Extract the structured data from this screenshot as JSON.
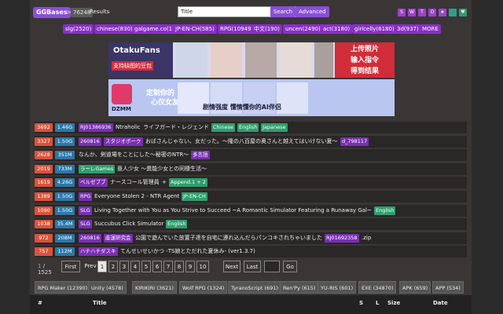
{
  "header": {
    "logo": "GGBases",
    "sep": ">",
    "count": "76248",
    "results_label": "Results",
    "search_value": "Title",
    "search_btn": "Search",
    "advanced_btn": "Advanced",
    "squares": [
      "S",
      "W",
      "T",
      "O",
      "★"
    ],
    "green_icons": [
      "green-square-icon",
      "heart-icon"
    ]
  },
  "tags": [
    "slg(2520)",
    "chinese(830)",
    "galgame.co(1)",
    "JP-EN-CH(585)",
    "RPG(10949)",
    "中文(190)",
    "uncen(2490)",
    "act(3180)",
    "girlcelly(6180)",
    "3d(937)",
    "MORE"
  ],
  "ads": {
    "brand1": "OtakuFans",
    "sub1": "支持缺图的豆包",
    "red1": "上传照片",
    "red2": "输入指令",
    "red3": "得到结果",
    "brand2": "DZMM",
    "mid2a": "定制你的",
    "mid2b": "心仪女友",
    "right2": "剧情强度 懂情懂你的AI伴侣"
  },
  "rows": [
    {
      "num": "3692",
      "size": "1.46G",
      "parts": [
        {
          "t": "RJ01386936",
          "c": "tpurple"
        },
        {
          "t": "Ntraholic",
          "c": "title"
        },
        {
          "t": "ライフガード・レジェンド",
          "c": "title"
        },
        {
          "t": "Chinese",
          "c": "tg"
        },
        {
          "t": "English",
          "c": "tg"
        },
        {
          "t": "Japanese",
          "c": "tg"
        }
      ]
    },
    {
      "num": "3327",
      "size": "1.50G",
      "parts": [
        {
          "t": "260816",
          "c": "tpurple"
        },
        {
          "t": "スタジオポーク",
          "c": "tpurple"
        },
        {
          "t": "おばさんじゃない、女だった。～隆の八百屋の奥さんと越えてはいけない夏～",
          "c": "title"
        },
        {
          "t": "d_798117",
          "c": "tpurple"
        }
      ]
    },
    {
      "num": "2628",
      "size": "351M",
      "parts": [
        {
          "t": "なんか、剣道場をことにした～秘密のNTR～",
          "c": "title"
        },
        {
          "t": "多言語",
          "c": "tpurple"
        }
      ]
    },
    {
      "num": "2019",
      "size": "733M",
      "parts": [
        {
          "t": "ラーレGames",
          "c": "tg"
        },
        {
          "t": "亜人少女 ～異能少女との同棲生活～",
          "c": "title"
        }
      ]
    },
    {
      "num": "1619",
      "size": "4.26G",
      "parts": [
        {
          "t": "ベルゼブブ",
          "c": "tpurple"
        },
        {
          "t": "ナースコール管理員",
          "c": "title"
        },
        {
          "t": "+",
          "c": "title"
        },
        {
          "t": "Append.1 + 2",
          "c": "tg"
        }
      ]
    },
    {
      "num": "1389",
      "size": "1.50G",
      "parts": [
        {
          "t": "RPG",
          "c": "tpurple"
        },
        {
          "t": "Everyone Stolen 2 - NTR Agent",
          "c": "title"
        },
        {
          "t": "JP-EN-CH",
          "c": "tg"
        }
      ]
    },
    {
      "num": "1090",
      "size": "1.50G",
      "parts": [
        {
          "t": "SLG",
          "c": "tpurple"
        },
        {
          "t": "Living Together with You as You Strive to Succeed ~A Romantic Simulator Featuring a Runaway Gal~",
          "c": "title"
        },
        {
          "t": "English",
          "c": "tg"
        }
      ]
    },
    {
      "num": "1038",
      "size": "35.4M",
      "parts": [
        {
          "t": "SLG",
          "c": "tpurple"
        },
        {
          "t": "Succubus Click Simulator",
          "c": "title"
        },
        {
          "t": "English",
          "c": "tg"
        }
      ]
    },
    {
      "num": "972",
      "size": "208M",
      "parts": [
        {
          "t": "260816",
          "c": "tpurple"
        },
        {
          "t": "座運研究会",
          "c": "tpurple"
        },
        {
          "t": "公園で遊んでいた放置子達を自宅に連れ込んだらパンコキされちゃいました",
          "c": "title"
        },
        {
          "t": "RJ01692358",
          "c": "tpurple"
        },
        {
          "t": ".zip",
          "c": "title"
        }
      ]
    },
    {
      "num": "757",
      "size": "112M",
      "parts": [
        {
          "t": "ハチハチダスキ",
          "c": "tpurple"
        },
        {
          "t": "てんせいせいかつ -TS娘とただれた夏休み- (ver1.3.7)",
          "c": "title"
        }
      ]
    }
  ],
  "pager": {
    "current": "1",
    "total": "/ 1525",
    "first": "First",
    "prev": "Prev",
    "pages": [
      "1",
      "2",
      "3",
      "4",
      "5",
      "6",
      "7",
      "8",
      "9",
      "10"
    ],
    "next": "Next",
    "last": "Last",
    "go": "Go"
  },
  "categories": [
    "RPG Maker (12390)",
    "Unity (4578)",
    "KIRIKIRI (3621)",
    "Wolf RPG (1324)",
    "TyranoScript (691)",
    "Ren'Py (615)",
    "YU-RIS (601)",
    "EXE (34870)",
    "APK (659)",
    "APP (534)"
  ],
  "table_headers": {
    "num": "#",
    "title": "Title",
    "s": "S",
    "l": "L",
    "size": "Size",
    "date": "Date"
  }
}
